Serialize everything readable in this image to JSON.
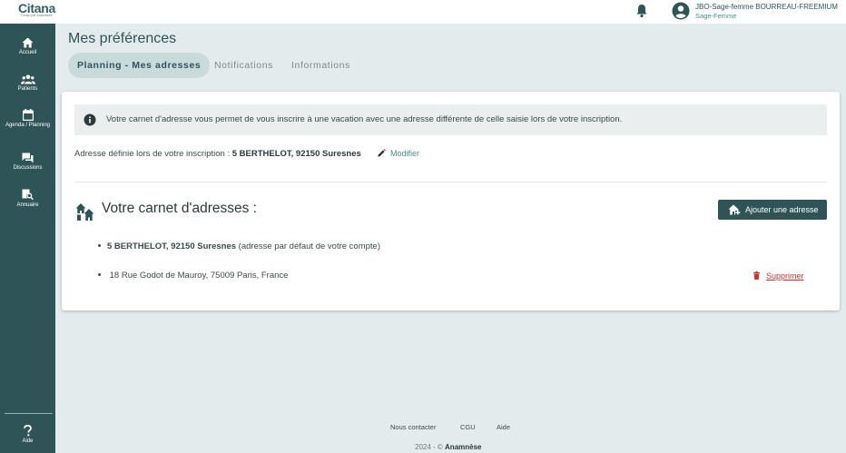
{
  "header": {
    "logo_text": "Citana",
    "logo_tagline": "Conçu par Anamnèse",
    "user_name": "JBO-Sage-femme BOURREAU-FREEMIUM",
    "user_role": "Sage-Femme"
  },
  "sidebar": {
    "items": [
      {
        "label": "Accueil",
        "icon": "home-icon"
      },
      {
        "label": "Patients",
        "icon": "people-icon"
      },
      {
        "label": "Agenda / Planning",
        "icon": "calendar-icon"
      },
      {
        "label": "Discussions",
        "icon": "chat-icon"
      },
      {
        "label": "Annuaire",
        "icon": "directory-icon"
      }
    ],
    "help": {
      "label": "Aide",
      "icon": "help-icon"
    }
  },
  "page": {
    "title": "Mes préférences",
    "tabs": [
      {
        "label": "Planning - Mes adresses",
        "active": true
      },
      {
        "label": "Notifications",
        "active": false
      },
      {
        "label": "Informations",
        "active": false
      }
    ]
  },
  "card": {
    "info_text": "Votre carnet d'adresse vous permet de vous inscrire à une vacation avec une adresse différente de celle saisie lors de votre inscription.",
    "registered_address_label": "Adresse définie lors de votre inscription : ",
    "registered_address_value": "5 BERTHELOT, 92150 Suresnes",
    "modify_label": "Modifier",
    "address_book_title": "Votre carnet d'adresses :",
    "add_address_label": "Ajouter une adresse",
    "addresses": [
      {
        "address": "5 BERTHELOT, 92150 Suresnes",
        "note": " (adresse par défaut de votre compte)"
      },
      {
        "address": "18 Rue Godot de Mauroy, 75009 Paris, France",
        "note": ""
      }
    ],
    "delete_label": "Supprimer"
  },
  "footer": {
    "links": [
      "Nous contacter",
      "CGU",
      "Aide"
    ],
    "copyright_prefix": "2024 - © ",
    "copyright_brand": "Anamnèse"
  },
  "colors": {
    "sidebar": "#2f5457",
    "accent": "#3e8f8a",
    "danger": "#d32f2f",
    "background": "#e4ebed"
  }
}
